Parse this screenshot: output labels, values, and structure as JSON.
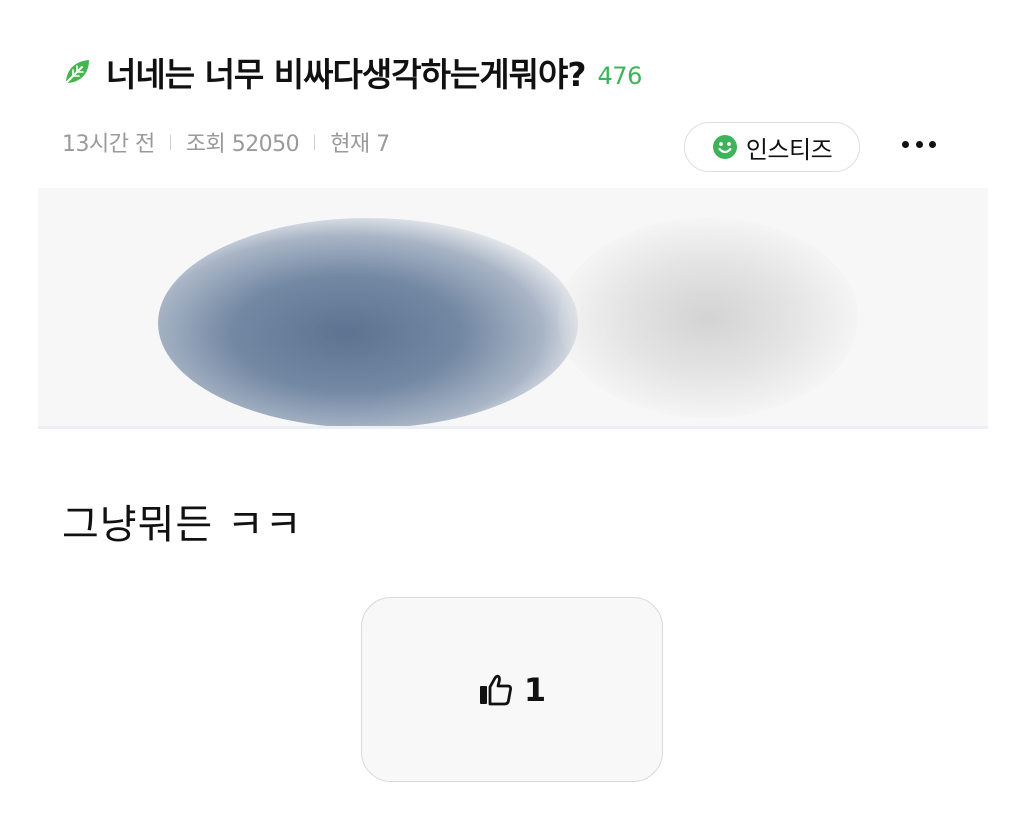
{
  "post": {
    "title": "너네는 너무 비싸다생각하는게뭐야?",
    "comment_count": "476",
    "time_ago": "13시간 전",
    "views": "조회 52050",
    "current": "현재 7",
    "board": "인스티즈",
    "body": "그냥뭐든 ㅋㅋ",
    "likes": "1"
  },
  "colors": {
    "accent_green": "#3fb35a",
    "leaf_green": "#45b64f"
  },
  "icons": {
    "title_icon": "leaf-icon",
    "board_icon": "smile-icon",
    "menu_icon": "more-icon",
    "like_icon": "thumbs-up-icon"
  }
}
